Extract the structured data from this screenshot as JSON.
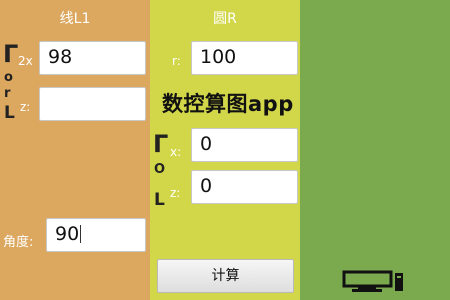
{
  "line_panel": {
    "title": "线L1",
    "fields": {
      "x2_label": "2x",
      "x2_value": "98",
      "z_label": "z:",
      "z_value": ""
    },
    "bracket_symbol": "Γ",
    "o_symbol": "o",
    "r_symbol": "r",
    "l_symbol": "L",
    "angle_label": "角度:",
    "angle_value": "90"
  },
  "circle_panel": {
    "title": "圆R",
    "r_label": "r:",
    "r_value": "100",
    "x_label": "x:",
    "x_value": "0",
    "z_label": "z:",
    "z_value": "0",
    "bracket_symbol": "Γ",
    "o_symbol": "O",
    "l_symbol": "L",
    "calc_button": "计算"
  },
  "overlay": {
    "app_title": "数控算图app"
  },
  "icons": {
    "computer": "computer-icon"
  },
  "colors": {
    "left_panel": "#dca75f",
    "middle_panel": "#d2d649",
    "right_panel": "#7aaa4d"
  }
}
